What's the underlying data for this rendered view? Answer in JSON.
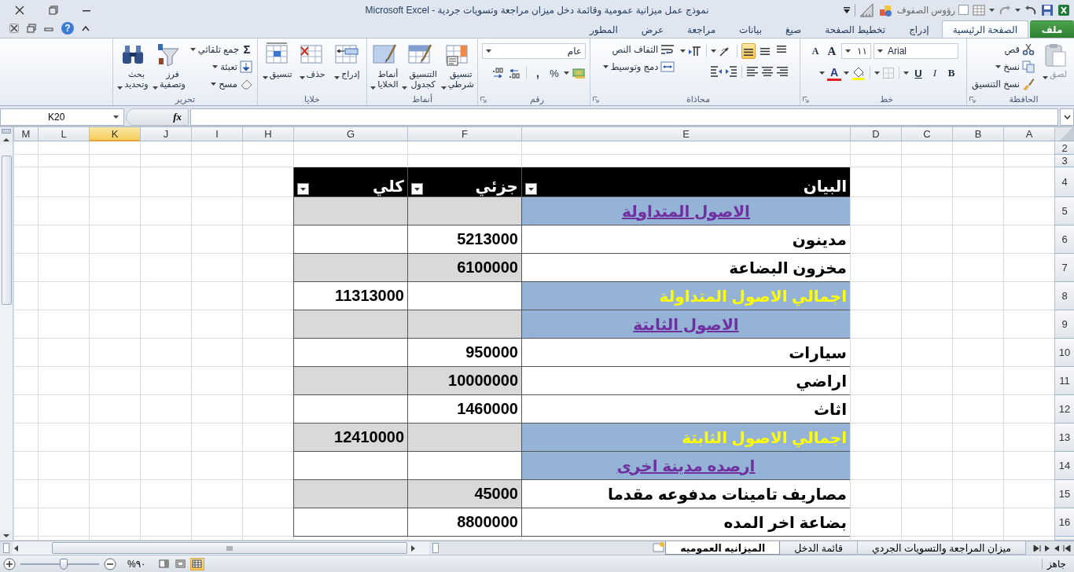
{
  "title_bar": {
    "title": "نموذج عمل ميزانية عمومية وقائمة دخل ميزان مراجعة وتسويات جردية - Microsoft Excel",
    "headers_checkbox": {
      "label": "رؤوس الصفوف",
      "checked": false
    }
  },
  "ribbon_bar": {
    "help": "?",
    "tabs": [
      {
        "label": "ملف",
        "kind": "file"
      },
      {
        "label": "الصفحة الرئيسية",
        "kind": "tab",
        "selected": true
      },
      {
        "label": "إدراج",
        "kind": "tab",
        "selected": false
      },
      {
        "label": "تخطيط الصفحة",
        "kind": "tab",
        "selected": false
      },
      {
        "label": "صيغ",
        "kind": "tab",
        "selected": false
      },
      {
        "label": "بيانات",
        "kind": "tab",
        "selected": false
      },
      {
        "label": "مراجعة",
        "kind": "tab",
        "selected": false
      },
      {
        "label": "عرض",
        "kind": "tab",
        "selected": false
      },
      {
        "label": "المطور",
        "kind": "tab",
        "selected": false
      }
    ]
  },
  "ribbon_groups": [
    {
      "kind": "clipboard",
      "label": "الحافظة",
      "paste": "لصق",
      "paste_disabled": true,
      "cut": "قص",
      "copy": "نسخ",
      "format_painter": "نسخ التنسيق"
    },
    {
      "kind": "font",
      "label": "خط",
      "font": "Arial",
      "size": "١١",
      "grow": "A",
      "shrink": "A",
      "bold": "B",
      "italic": "I",
      "underline": "U",
      "font_color": "A"
    },
    {
      "kind": "alignment",
      "label": "محاذاة",
      "vertical_align": [
        {
          "selected": false
        },
        {
          "selected": false
        },
        {
          "selected": true
        }
      ],
      "wrap": "التفاف النص",
      "merge": "دمج وتوسيط"
    },
    {
      "kind": "number",
      "label": "رقم",
      "format": "عام",
      "percent": "%",
      "comma": ","
    },
    {
      "kind": "styles",
      "label": "أنماط",
      "buttons": [
        "تنسيق شرطي",
        "التنسيق كجدول",
        "أنماط الخلايا"
      ]
    },
    {
      "kind": "cells",
      "label": "خلايا",
      "buttons": [
        "إدراج",
        "حذف",
        "تنسيق"
      ]
    },
    {
      "kind": "editing",
      "label": "تحرير",
      "autosum_symbol": "Σ",
      "autosum": "جمع تلقائي",
      "fill": "تعبئة",
      "clear": "مسح",
      "sort": "فرز وتصفية",
      "find": "بحث وتحديد"
    }
  ],
  "formula_bar": {
    "name_box": "K20",
    "function_label": "fx"
  },
  "sheet": {
    "columns": [
      {
        "label": "A",
        "selected": false
      },
      {
        "label": "B",
        "selected": false
      },
      {
        "label": "C",
        "selected": false
      },
      {
        "label": "D",
        "selected": false
      },
      {
        "label": "E",
        "selected": false
      },
      {
        "label": "F",
        "selected": false
      },
      {
        "label": "G",
        "selected": false
      },
      {
        "label": "H",
        "selected": false
      },
      {
        "label": "I",
        "selected": false
      },
      {
        "label": "J",
        "selected": false
      },
      {
        "label": "K",
        "selected": true
      },
      {
        "label": "L",
        "selected": false
      },
      {
        "label": "M",
        "selected": false
      }
    ],
    "rows": [
      {
        "number": "2",
        "kind": "blank"
      },
      {
        "number": "3",
        "kind": "blank"
      },
      {
        "number": "4",
        "kind": "header",
        "cells": [
          "البيان",
          "جزئي",
          "كلي"
        ]
      },
      {
        "number": "5",
        "kind": "section",
        "label": "الاصول المتداولة",
        "shaded": true
      },
      {
        "number": "6",
        "kind": "item",
        "label": "مدينون",
        "value": "5213000",
        "shaded": false
      },
      {
        "number": "7",
        "kind": "item",
        "label": "مخزون البضاعة",
        "value": "6100000",
        "shaded": true
      },
      {
        "number": "8",
        "kind": "total",
        "label": "اجمالي الاصول المتداولة",
        "value": "11313000",
        "shaded": false
      },
      {
        "number": "9",
        "kind": "section",
        "label": "الاصول الثابتة",
        "shaded": true
      },
      {
        "number": "10",
        "kind": "item",
        "label": "سيارات",
        "value": "950000",
        "shaded": false
      },
      {
        "number": "11",
        "kind": "item",
        "label": "اراضي",
        "value": "10000000",
        "shaded": true
      },
      {
        "number": "12",
        "kind": "item",
        "label": "اثاث",
        "value": "1460000",
        "shaded": false
      },
      {
        "number": "13",
        "kind": "total",
        "label": "اجمالي الاصول الثابتة",
        "value": "12410000",
        "shaded": true
      },
      {
        "number": "14",
        "kind": "section",
        "label": "ارصده مدينة اخرى",
        "shaded": false
      },
      {
        "number": "15",
        "kind": "item",
        "label": "مصاريف تامينات مدفوعه مقدما",
        "value": "45000",
        "shaded": true
      },
      {
        "number": "16",
        "kind": "item",
        "label": "بضاعة اخر المده",
        "value": "8800000",
        "shaded": false
      }
    ]
  },
  "sheet_tabs": [
    {
      "label": "ميزان المراجعة والتسويات الجردي",
      "selected": false
    },
    {
      "label": "قائمة الدخل",
      "selected": false
    },
    {
      "label": "الميزانيه العموميه",
      "selected": true
    }
  ],
  "status_bar": {
    "status": "جاهز",
    "zoom": {
      "label": "%٩٠",
      "level": 0.55
    },
    "views": [
      {
        "selected": true
      },
      {
        "selected": false
      },
      {
        "selected": false
      }
    ]
  }
}
